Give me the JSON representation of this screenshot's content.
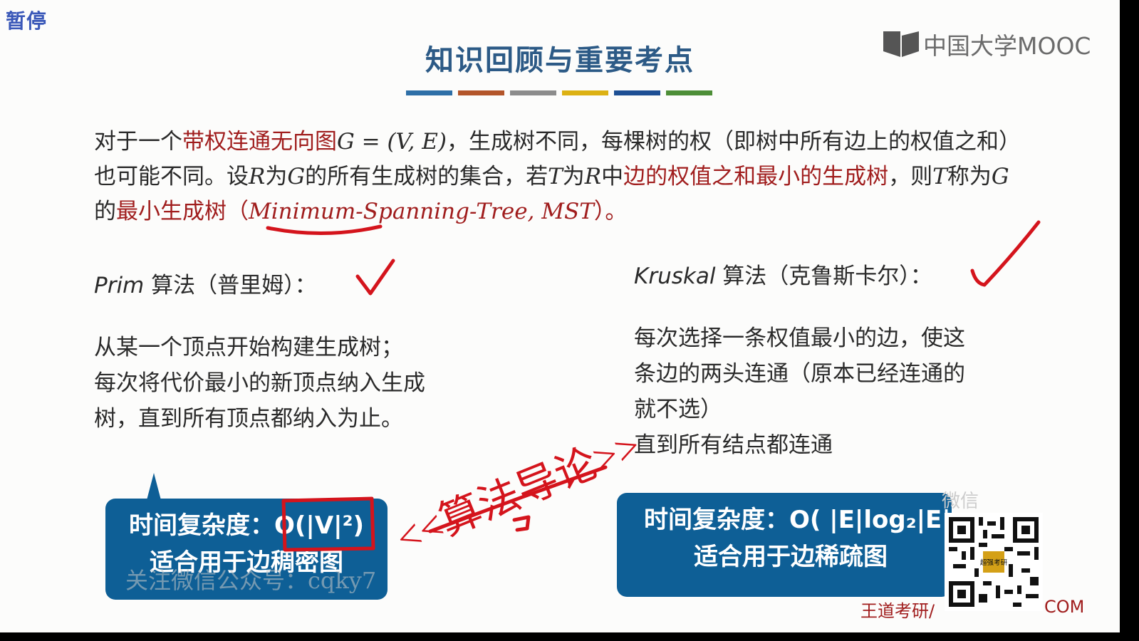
{
  "overlay": {
    "pause_label": "暂停",
    "brand": "中国大学MOOC",
    "watermark": "关注微信公众号：cqky7",
    "watermark_sub": "",
    "weixin_label": "微信",
    "footer_left": "王道考研/",
    "footer_right": "COM",
    "qr_center": "超强考研"
  },
  "slide": {
    "title": "知识回顾与重要考点",
    "color_bar": [
      "#2e6fa7",
      "#b3552a",
      "#8c8c8c",
      "#dcb113",
      "#1d4f94",
      "#4d8e37"
    ],
    "para": {
      "s1": "对于一个",
      "s2": "带权连通无向图",
      "s3": "G = (V, E)",
      "s4": "，生成树不同，每棵树的权（即树中所有边上的权值之和）也可能不同。设",
      "s5": "R",
      "s6": "为",
      "s7": "G",
      "s8": "的所有生成树的集合，若",
      "s9": "T",
      "s10": "为",
      "s11": "R",
      "s12": "中",
      "s13": "边的权值之和最小的生成树",
      "s14": "，则",
      "s15": "T",
      "s16": "称为",
      "s17": "G",
      "s18": "的",
      "s19": "最小生成树",
      "s20": "（",
      "s21": "Minimum-Spanning-Tree, MST",
      "s22": "）。"
    },
    "prim": {
      "name": "Prim",
      "head": " 算法（普里姆）：",
      "lines": [
        "从某一个顶点开始构建生成树；",
        "每次将代价最小的新顶点纳入生成",
        "树，直到所有顶点都纳入为止。"
      ],
      "bubble_line1": "时间复杂度：O(|V|²)",
      "bubble_line2": "适合用于边稠密图"
    },
    "kruskal": {
      "name": "Kruskal",
      "head": " 算法（克鲁斯卡尔）：",
      "lines": [
        "每次选择一条权值最小的边，使这",
        "条边的两头连通（原本已经连通的",
        "就不选）",
        "直到所有结点都连通"
      ],
      "bubble_line1": "时间复杂度：O( |E|log₂|E|",
      "bubble_line2": "适合用于边稀疏图"
    },
    "handwriting": "<<算法导论>>",
    "ink_color": "#d4141c"
  }
}
